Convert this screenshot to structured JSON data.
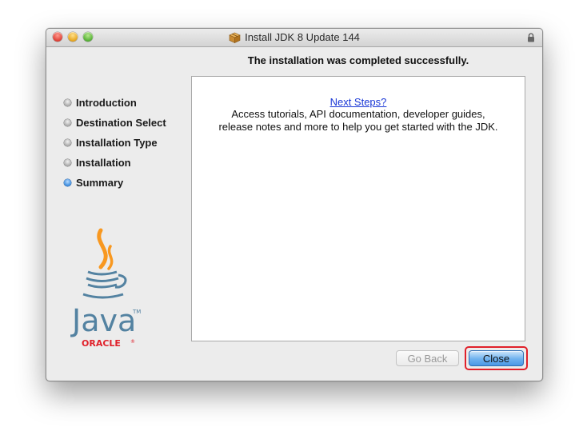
{
  "window": {
    "title": "Install JDK 8 Update 144"
  },
  "page": {
    "heading": "The installation was completed successfully."
  },
  "steps": [
    {
      "label": "Introduction",
      "active": false
    },
    {
      "label": "Destination Select",
      "active": false
    },
    {
      "label": "Installation Type",
      "active": false
    },
    {
      "label": "Installation",
      "active": false
    },
    {
      "label": "Summary",
      "active": true
    }
  ],
  "content": {
    "next_steps_link": "Next Steps?",
    "description_line1": "Access tutorials, API documentation, developer guides,",
    "description_line2": "release notes and more to help you get started with the JDK."
  },
  "buttons": {
    "go_back": "Go Back",
    "close": "Close"
  },
  "logo": {
    "java_text": "Java",
    "trademark": "TM",
    "oracle_text": "ORACLE",
    "registered": "®"
  },
  "colors": {
    "accent_blue": "#3f8fe0",
    "link_blue": "#1a38d6",
    "highlight_red": "#e0202a",
    "java_blue": "#5382a1",
    "java_orange": "#f89820",
    "oracle_red": "#e0202a"
  },
  "icons": {
    "title_icon": "package-icon",
    "lock_icon": "lock-icon"
  }
}
